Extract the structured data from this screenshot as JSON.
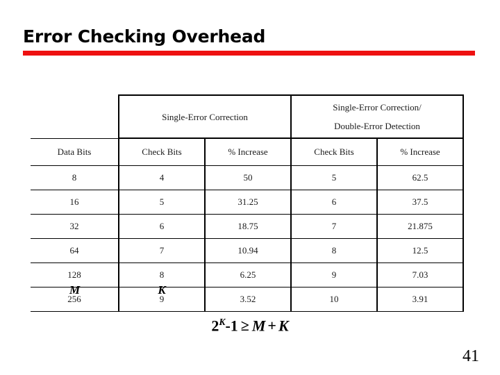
{
  "slide": {
    "title": "Error Checking Overhead",
    "accent_color": "#ee1111",
    "page_number": "41"
  },
  "table": {
    "group_headers": [
      {
        "label": "",
        "span": 1
      },
      {
        "label": "Single-Error Correction",
        "span": 2
      },
      {
        "label": "Single-Error Correction/\nDouble-Error Detection",
        "span": 2
      }
    ],
    "group_header_sec_line1": "Single-Error Correction",
    "group_header_secded_line1": "Single-Error Correction/",
    "group_header_secded_line2": "Double-Error Detection",
    "columns": [
      "Data Bits",
      "Check Bits",
      "% Increase",
      "Check Bits",
      "% Increase"
    ],
    "rows": [
      [
        "8",
        "4",
        "50",
        "5",
        "62.5"
      ],
      [
        "16",
        "5",
        "31.25",
        "6",
        "37.5"
      ],
      [
        "32",
        "6",
        "18.75",
        "7",
        "21.875"
      ],
      [
        "64",
        "7",
        "10.94",
        "8",
        "12.5"
      ],
      [
        "128",
        "8",
        "6.25",
        "9",
        "7.03"
      ],
      [
        "256",
        "9",
        "3.52",
        "10",
        "3.91"
      ]
    ]
  },
  "annotations": {
    "data_bits_symbol": "M",
    "check_bits_symbol": "K"
  },
  "formula": {
    "base": "2",
    "exponent": "K",
    "minus_one": "-1",
    "relation": "≥",
    "left_var": "M",
    "plus": "+",
    "right_var": "K",
    "plain": "2^K-1 ≥ M + K"
  }
}
